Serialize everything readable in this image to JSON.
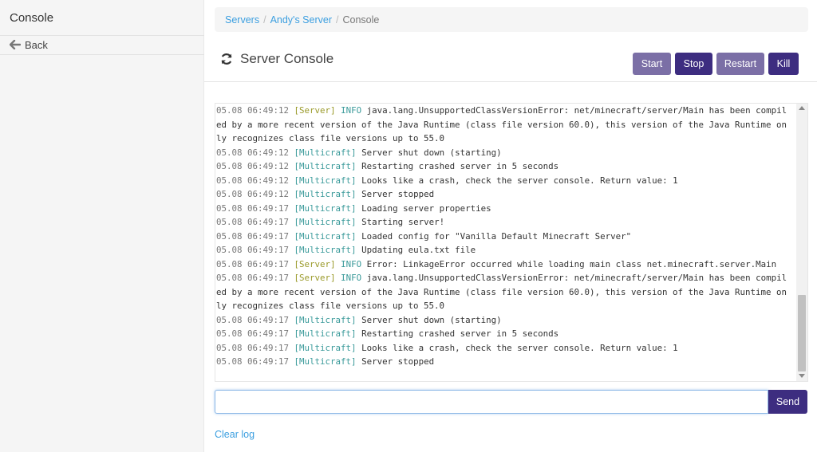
{
  "sidebar": {
    "title": "Console",
    "back_label": "Back"
  },
  "breadcrumb": {
    "items": [
      "Servers",
      "Andy's Server"
    ],
    "current": "Console"
  },
  "page": {
    "title": "Server Console"
  },
  "actions": {
    "start": "Start",
    "stop": "Stop",
    "restart": "Restart",
    "kill": "Kill"
  },
  "console": {
    "lines": [
      {
        "ts": "05.08 06:49:12",
        "tag": "[Server]",
        "type": "server",
        "level": "INFO",
        "msg": "java.lang.UnsupportedClassVersionError: net/minecraft/server/Main has been compiled by a more recent version of the Java Runtime (class file version 60.0), this version of the Java Runtime only recognizes class file versions up to 55.0"
      },
      {
        "ts": "05.08 06:49:12",
        "tag": "[Multicraft]",
        "type": "mc",
        "level": "",
        "msg": "Server shut down (starting)"
      },
      {
        "ts": "05.08 06:49:12",
        "tag": "[Multicraft]",
        "type": "mc",
        "level": "",
        "msg": "Restarting crashed server in 5 seconds"
      },
      {
        "ts": "05.08 06:49:12",
        "tag": "[Multicraft]",
        "type": "mc",
        "level": "",
        "msg": "Looks like a crash, check the server console. Return value: 1"
      },
      {
        "ts": "05.08 06:49:12",
        "tag": "[Multicraft]",
        "type": "mc",
        "level": "",
        "msg": "Server stopped"
      },
      {
        "ts": "05.08 06:49:17",
        "tag": "[Multicraft]",
        "type": "mc",
        "level": "",
        "msg": "Loading server properties"
      },
      {
        "ts": "05.08 06:49:17",
        "tag": "[Multicraft]",
        "type": "mc",
        "level": "",
        "msg": "Starting server!"
      },
      {
        "ts": "05.08 06:49:17",
        "tag": "[Multicraft]",
        "type": "mc",
        "level": "",
        "msg": "Loaded config for \"Vanilla Default Minecraft Server\""
      },
      {
        "ts": "05.08 06:49:17",
        "tag": "[Multicraft]",
        "type": "mc",
        "level": "",
        "msg": "Updating eula.txt file"
      },
      {
        "ts": "05.08 06:49:17",
        "tag": "[Server]",
        "type": "server",
        "level": "INFO",
        "msg": "Error: LinkageError occurred while loading main class net.minecraft.server.Main"
      },
      {
        "ts": "05.08 06:49:17",
        "tag": "[Server]",
        "type": "server",
        "level": "INFO",
        "msg": "java.lang.UnsupportedClassVersionError: net/minecraft/server/Main has been compiled by a more recent version of the Java Runtime (class file version 60.0), this version of the Java Runtime only recognizes class file versions up to 55.0"
      },
      {
        "ts": "05.08 06:49:17",
        "tag": "[Multicraft]",
        "type": "mc",
        "level": "",
        "msg": "Server shut down (starting)"
      },
      {
        "ts": "05.08 06:49:17",
        "tag": "[Multicraft]",
        "type": "mc",
        "level": "",
        "msg": "Restarting crashed server in 5 seconds"
      },
      {
        "ts": "05.08 06:49:17",
        "tag": "[Multicraft]",
        "type": "mc",
        "level": "",
        "msg": "Looks like a crash, check the server console. Return value: 1"
      },
      {
        "ts": "05.08 06:49:17",
        "tag": "[Multicraft]",
        "type": "mc",
        "level": "",
        "msg": "Server stopped"
      }
    ]
  },
  "command": {
    "value": "",
    "send_label": "Send"
  },
  "footer": {
    "clear_log": "Clear log"
  },
  "icons": {
    "back": "arrow-left-icon",
    "title": "refresh-icon"
  },
  "colors": {
    "primary": "#3d2d80",
    "primary_light": "#7b6fa6",
    "link": "#3c9fe0"
  }
}
